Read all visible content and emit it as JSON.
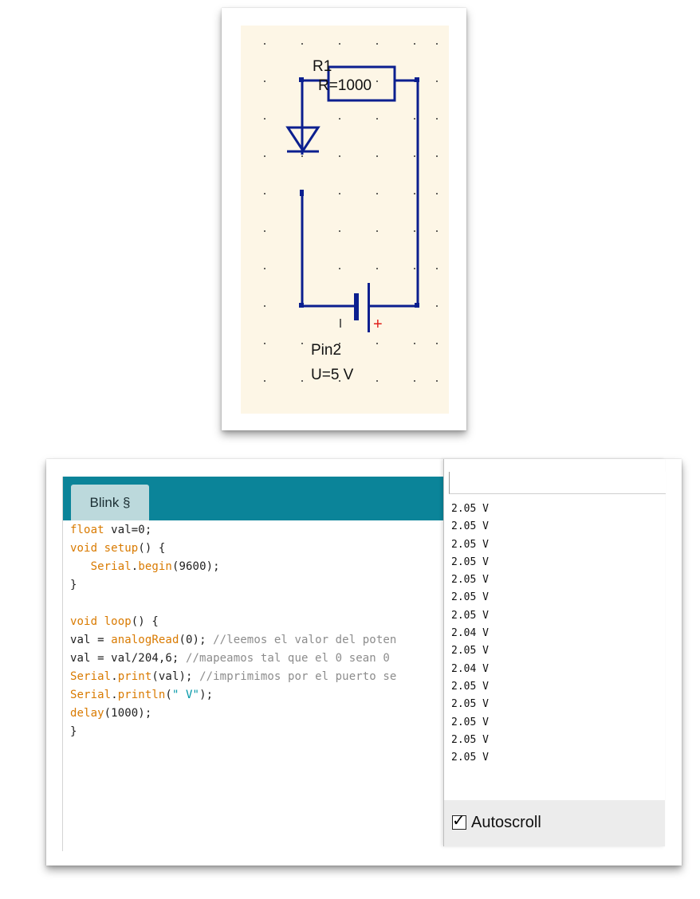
{
  "schematic": {
    "resistor_name": "R1",
    "resistor_value": "R=1000",
    "source_name": "Pin2",
    "source_voltage": "U=5 V",
    "positive_marker": "+",
    "wire_color": "#0b1f8f",
    "marker_color": "#e0201a",
    "background_color": "#fdf6e6"
  },
  "ide": {
    "tab_label": "Blink §",
    "header_color": "#0b8499",
    "code_lines": [
      [
        {
          "t": "float",
          "c": "kw-orange"
        },
        {
          "t": " val=0;"
        }
      ],
      [
        {
          "t": "void",
          "c": "kw-orange"
        },
        {
          "t": " "
        },
        {
          "t": "setup",
          "c": "kw-orange"
        },
        {
          "t": "() {"
        }
      ],
      [
        {
          "t": "   "
        },
        {
          "t": "Serial",
          "c": "kw-orange"
        },
        {
          "t": "."
        },
        {
          "t": "begin",
          "c": "kw-orange"
        },
        {
          "t": "(9600);"
        }
      ],
      [
        {
          "t": "}"
        }
      ],
      [
        {
          "t": ""
        }
      ],
      [
        {
          "t": "void",
          "c": "kw-orange"
        },
        {
          "t": " "
        },
        {
          "t": "loop",
          "c": "kw-orange"
        },
        {
          "t": "() {"
        }
      ],
      [
        {
          "t": "val = "
        },
        {
          "t": "analogRead",
          "c": "kw-orange"
        },
        {
          "t": "(0); "
        },
        {
          "t": "//leemos el valor del poten",
          "c": "cmt"
        }
      ],
      [
        {
          "t": "val = val/204,6; "
        },
        {
          "t": "//mapeamos tal que el 0 sean 0",
          "c": "cmt"
        }
      ],
      [
        {
          "t": "Serial",
          "c": "kw-orange"
        },
        {
          "t": "."
        },
        {
          "t": "print",
          "c": "kw-orange"
        },
        {
          "t": "(val); "
        },
        {
          "t": "//imprimimos por el puerto se",
          "c": "cmt"
        }
      ],
      [
        {
          "t": "Serial",
          "c": "kw-orange"
        },
        {
          "t": "."
        },
        {
          "t": "println",
          "c": "kw-orange"
        },
        {
          "t": "("
        },
        {
          "t": "\" V\"",
          "c": "kw-teal"
        },
        {
          "t": ");"
        }
      ],
      [
        {
          "t": "delay",
          "c": "kw-orange"
        },
        {
          "t": "(1000);"
        }
      ],
      [
        {
          "t": "}"
        }
      ]
    ]
  },
  "serial_monitor": {
    "input_value": "",
    "lines": [
      "2.05 V",
      "2.05 V",
      "2.05 V",
      "2.05 V",
      "2.05 V",
      "2.05 V",
      "2.05 V",
      "2.04 V",
      "2.05 V",
      "2.04 V",
      "2.05 V",
      "2.05 V",
      "2.05 V",
      "2.05 V",
      "2.05 V"
    ],
    "autoscroll_label": "Autoscroll",
    "autoscroll_checked": true
  }
}
